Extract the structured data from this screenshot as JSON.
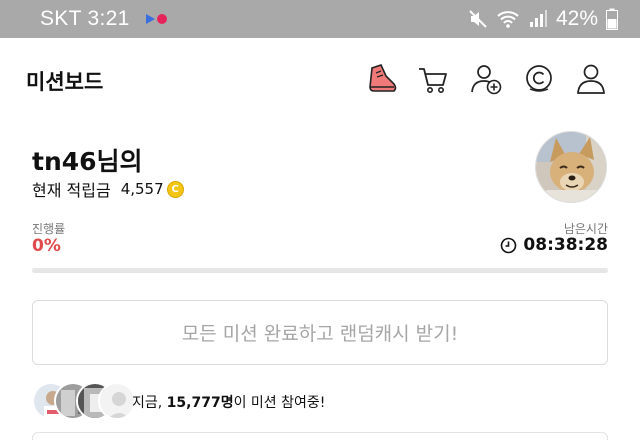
{
  "status_bar": {
    "carrier_time": "SKT 3:21",
    "battery": "42%"
  },
  "app": {
    "title": "미션보드"
  },
  "header_icons": [
    "mission-sneaker-icon",
    "cart-icon",
    "add-friend-icon",
    "coin-c-icon",
    "profile-icon"
  ],
  "user": {
    "name": "tn46님의",
    "points_label": "현재 적립금",
    "points_value": "4,557",
    "coin_symbol": "C"
  },
  "progress": {
    "label": "진행률",
    "value_text": "0%",
    "fraction": 0
  },
  "time_left": {
    "label": "남은시간",
    "value": "08:38:28"
  },
  "reward_button": {
    "label": "모든 미션 완료하고 랜덤캐시 받기!"
  },
  "participants": {
    "prefix": "지금, ",
    "count": "15,777명",
    "suffix": "이 미션 참여중!"
  },
  "colors": {
    "accent_red": "#e04a4a",
    "coin_yellow": "#f4c514",
    "status_bar": "#a9a9a9"
  }
}
